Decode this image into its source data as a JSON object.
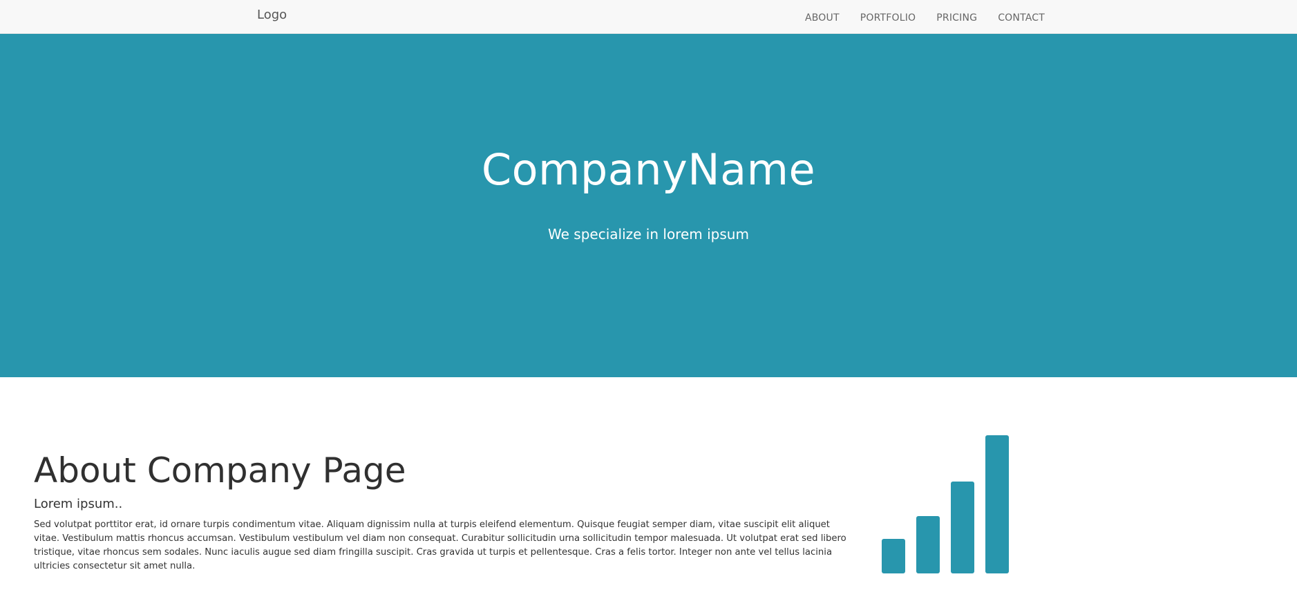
{
  "navbar": {
    "brand": "Logo",
    "links": [
      "ABOUT",
      "PORTFOLIO",
      "PRICING",
      "CONTACT"
    ]
  },
  "hero": {
    "title": "CompanyName",
    "subtitle": "We specialize in lorem ipsum"
  },
  "about": {
    "title": "About Company Page",
    "lead": "Lorem ipsum..",
    "body": "Sed volutpat porttitor erat, id ornare turpis condimentum vitae. Aliquam dignissim nulla at turpis eleifend elementum. Quisque feugiat semper diam, vitae suscipit elit aliquet vitae. Vestibulum mattis rhoncus accumsan. Vestibulum vestibulum vel diam non consequat. Curabitur sollicitudin urna sollicitudin tempor malesuada. Ut volutpat erat sed libero tristique, vitae rhoncus sem sodales. Nunc iaculis augue sed diam fringilla suscipit. Cras gravida ut turpis et pellentesque. Cras a felis tortor. Integer non ante vel tellus lacinia ultricies consectetur sit amet nulla.",
    "icon": "signal-icon"
  },
  "colors": {
    "accent": "#2896ad",
    "navbar_bg": "#f8f8f8",
    "text": "#333333"
  }
}
